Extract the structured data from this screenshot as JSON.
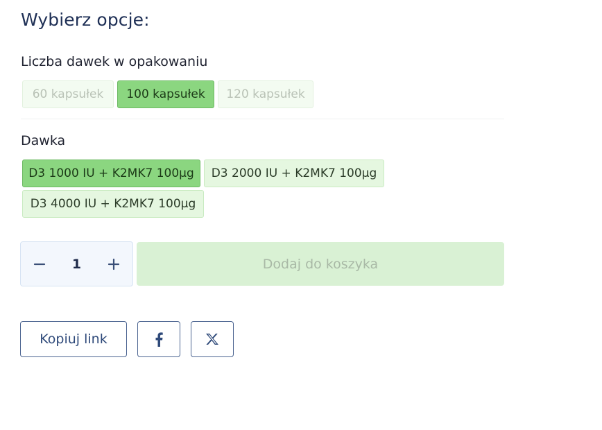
{
  "heading": "Wybierz opcje:",
  "pack_size": {
    "label": "Liczba dawek w opakowaniu",
    "options": [
      {
        "label": "60 kapsułek",
        "state": "disabled"
      },
      {
        "label": "100 kapsułek",
        "state": "selected"
      },
      {
        "label": "120 kapsułek",
        "state": "disabled"
      }
    ]
  },
  "dose": {
    "label": "Dawka",
    "options": [
      {
        "label": "D3 1000 IU + K2MK7 100µg",
        "state": "selected"
      },
      {
        "label": "D3 2000 IU + K2MK7 100µg",
        "state": "available"
      },
      {
        "label": "D3 4000 IU + K2MK7 100µg",
        "state": "available"
      }
    ]
  },
  "quantity": {
    "value": "1",
    "minus_icon": "minus-icon",
    "plus_icon": "plus-icon"
  },
  "add_to_cart": {
    "label": "Dodaj do koszyka",
    "enabled": false
  },
  "share": {
    "copy_link_label": "Kopiuj link",
    "facebook_icon": "facebook-icon",
    "x_icon": "x-twitter-icon"
  },
  "colors": {
    "selected_bg": "#8bd680",
    "available_bg": "#e5f7e0",
    "disabled_bg": "#f3fbf1",
    "cta_disabled_bg": "#d9f1d4",
    "text_primary": "#1e2f55"
  }
}
